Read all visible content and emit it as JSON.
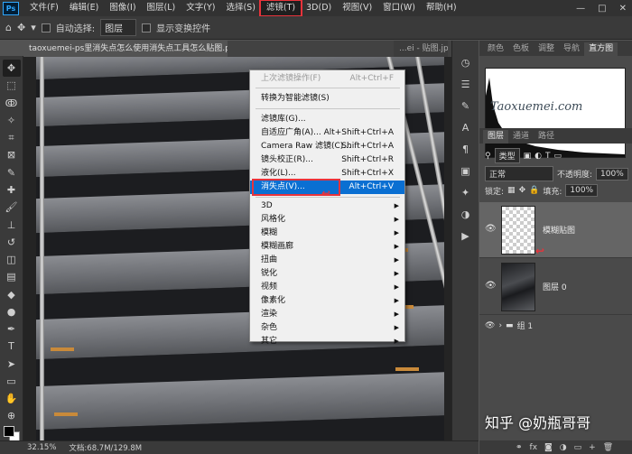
{
  "menubar": {
    "logo": "Ps",
    "items": [
      "文件(F)",
      "编辑(E)",
      "图像(I)",
      "图层(L)",
      "文字(Y)",
      "选择(S)",
      "滤镜(T)",
      "3D(D)",
      "视图(V)",
      "窗口(W)",
      "帮助(H)"
    ],
    "window_controls": [
      "—",
      "□",
      "✕"
    ]
  },
  "options_bar": {
    "auto_select_label": "自动选择:",
    "auto_select_value": "图层",
    "show_transform_label": "显示变换控件"
  },
  "tabs": [
    {
      "label": "taoxuemei-ps里消失点怎么使用消失点工具怎么贴图.psd @ 32.1% ..."
    },
    {
      "label": "...ei - 贴图.jpg"
    }
  ],
  "filter_menu": {
    "items": [
      {
        "label": "上次滤镜操作(F)",
        "shortcut": "Alt+Ctrl+F",
        "disabled": true
      },
      {
        "label": "转换为智能滤镜(S)",
        "shortcut": ""
      },
      {
        "label": "滤镜库(G)...",
        "shortcut": ""
      },
      {
        "label": "自适应广角(A)...",
        "shortcut": "Alt+Shift+Ctrl+A"
      },
      {
        "label": "Camera Raw 滤镜(C)...",
        "shortcut": "Shift+Ctrl+A"
      },
      {
        "label": "镜头校正(R)...",
        "shortcut": "Shift+Ctrl+R"
      },
      {
        "label": "液化(L)...",
        "shortcut": "Shift+Ctrl+X"
      },
      {
        "label": "消失点(V)...",
        "shortcut": "Alt+Ctrl+V",
        "highlighted": true
      },
      {
        "label": "3D",
        "submenu": true
      },
      {
        "label": "风格化",
        "submenu": true
      },
      {
        "label": "模糊",
        "submenu": true
      },
      {
        "label": "模糊画廊",
        "submenu": true
      },
      {
        "label": "扭曲",
        "submenu": true
      },
      {
        "label": "锐化",
        "submenu": true
      },
      {
        "label": "视频",
        "submenu": true
      },
      {
        "label": "像素化",
        "submenu": true
      },
      {
        "label": "渲染",
        "submenu": true
      },
      {
        "label": "杂色",
        "submenu": true
      },
      {
        "label": "其它",
        "submenu": true
      }
    ]
  },
  "panels": {
    "top_tabs": [
      "颜色",
      "色板",
      "调整",
      "导航",
      "直方图"
    ],
    "histogram_watermark": "Taoxuemei.com",
    "layer_tabs": [
      "图层",
      "通道",
      "路径"
    ],
    "kind_label": "类型",
    "blend_mode": "正常",
    "opacity_label": "不透明度:",
    "opacity_value": "100%",
    "lock_label": "锁定:",
    "fill_label": "填充:",
    "fill_value": "100%",
    "layers": [
      {
        "name": "模糊贴图",
        "selected": true
      },
      {
        "name": "图层 0",
        "selected": false
      }
    ],
    "group": {
      "name": "组 1"
    }
  },
  "status": {
    "zoom": "32.15%",
    "doc_info": "文档:68.7M/129.8M"
  },
  "watermark": "知乎 @奶瓶哥哥",
  "colors": {
    "highlight": "#0a6fd2",
    "annotation_red": "#e8333b"
  }
}
